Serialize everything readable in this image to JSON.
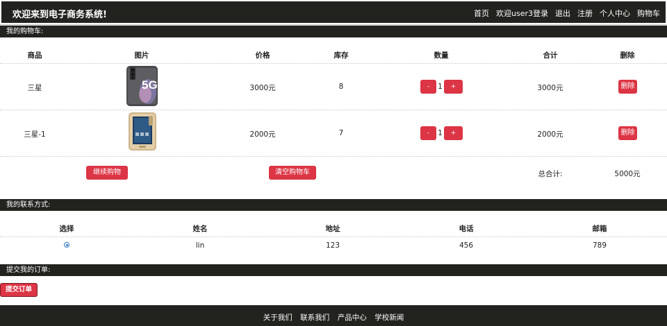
{
  "header": {
    "brand": "欢迎来到电子商务系统!",
    "nav": [
      "首页",
      "欢迎user3登录",
      "退出",
      "注册",
      "个人中心",
      "购物车"
    ]
  },
  "cart": {
    "section_title": "我的购物车:",
    "columns": [
      "商品",
      "图片",
      "价格",
      "库存",
      "数量",
      "合计",
      "删除"
    ],
    "items": [
      {
        "name": "三星",
        "image": "phone-image-samsung-s20-5g",
        "price": "3000元",
        "stock": "8",
        "qty_minus": "-",
        "qty": "1",
        "qty_plus": "+",
        "subtotal": "3000元",
        "delete_label": "删除"
      },
      {
        "name": "三星-1",
        "image": "phone-image-samsung-gold",
        "price": "2000元",
        "stock": "7",
        "qty_minus": "-",
        "qty": "1",
        "qty_plus": "+",
        "subtotal": "2000元",
        "delete_label": "删除"
      }
    ],
    "continue_label": "继续购物",
    "clear_label": "清空购物车",
    "total_label": "总合计:",
    "total_value": "5000元"
  },
  "contact": {
    "section_title": "我的联系方式:",
    "columns": [
      "选择",
      "姓名",
      "地址",
      "电话",
      "邮箱"
    ],
    "rows": [
      {
        "selected": true,
        "name": "lin",
        "address": "123",
        "phone": "456",
        "email": "789"
      }
    ]
  },
  "order": {
    "section_title": "提交我的订单:",
    "submit_label": "提交订单"
  },
  "footer": {
    "links": [
      "关于我们",
      "联系我们",
      "产品中心",
      "学校新闻"
    ]
  },
  "colors": {
    "bar": "#22221f",
    "accent": "#dc3545",
    "radio": "#2f74c8"
  }
}
